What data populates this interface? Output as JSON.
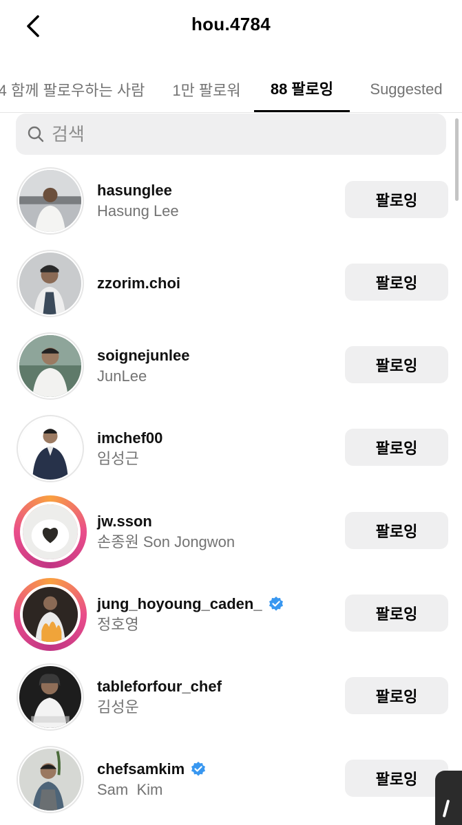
{
  "header": {
    "title": "hou.4784"
  },
  "tabs": [
    {
      "label": "4 함께 팔로우하는 사람",
      "active": false
    },
    {
      "label": "1만 팔로워",
      "active": false
    },
    {
      "label": "88 팔로잉",
      "active": true
    },
    {
      "label": "Suggested",
      "active": false
    }
  ],
  "search": {
    "placeholder": "검색"
  },
  "users": [
    {
      "username": "hasunglee",
      "fullname": "Hasung Lee",
      "verified": false,
      "story_ring": false,
      "button": "팔로잉"
    },
    {
      "username": "zzorim.choi",
      "fullname": "",
      "verified": false,
      "story_ring": false,
      "button": "팔로잉"
    },
    {
      "username": "soignejunlee",
      "fullname": "JunLee",
      "verified": false,
      "story_ring": false,
      "button": "팔로잉"
    },
    {
      "username": "imchef00",
      "fullname": "임성근",
      "verified": false,
      "story_ring": false,
      "button": "팔로잉"
    },
    {
      "username": "jw.sson",
      "fullname": "손종원 Son Jongwon",
      "verified": false,
      "story_ring": true,
      "button": "팔로잉"
    },
    {
      "username": "jung_hoyoung_caden_",
      "fullname": "정호영",
      "verified": true,
      "story_ring": true,
      "button": "팔로잉"
    },
    {
      "username": "tableforfour_chef",
      "fullname": "김성운",
      "verified": false,
      "story_ring": false,
      "button": "팔로잉"
    },
    {
      "username": "chefsamkim",
      "fullname": "Sam  Kim",
      "verified": true,
      "story_ring": false,
      "button": "팔로잉"
    }
  ],
  "colors": {
    "verified_blue": "#3897f0",
    "button_bg": "#efeff0",
    "secondary_text": "#737373"
  }
}
